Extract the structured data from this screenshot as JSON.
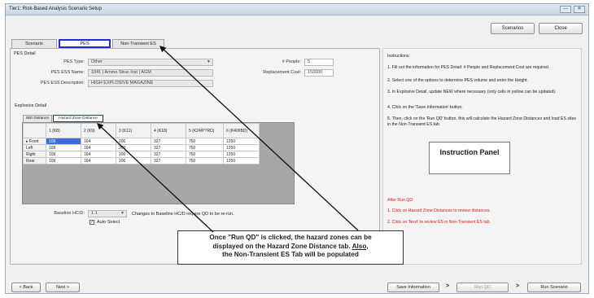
{
  "window": {
    "title": "Tier1: Risk-Based Analysis Scenario Setup",
    "controls": [
      "—",
      "✕"
    ]
  },
  "top_buttons": {
    "scenarios": "Scenarios",
    "close": "Close"
  },
  "tabs": [
    {
      "label": "Scenario",
      "active": false
    },
    {
      "label": "PES",
      "active": true
    },
    {
      "label": "Non-Transient ES",
      "active": false
    }
  ],
  "pes_detail": {
    "section_label": "PES Detail",
    "pes_type_label": "PES Type:",
    "pes_type_value": "Other",
    "pes_ess_name_label": "PES ESS Name:",
    "pes_ess_name_value": "1041 | Ammo Struc Inst | AGM",
    "pes_ess_desc_label": "PES ESS Description:",
    "pes_ess_desc_value": "HIGH EXPLOSIVE MAGAZINE",
    "people_label": "# People:",
    "people_value": "5",
    "replacement_label": "Replacement Cost:",
    "replacement_value": "150000"
  },
  "explosive_detail": {
    "section_label": "Explosive Detail",
    "subtabs": [
      {
        "label": "IBD Distance",
        "active": false
      },
      {
        "label": "Hazard Zone Distance",
        "active": true
      }
    ],
    "columns": [
      "",
      "1 (K8)",
      "2 (K9)",
      "3 (K11)",
      "4 (K18)",
      "5 (K24/PTRD)",
      "6 (K40/IBD)"
    ],
    "rows": [
      {
        "label": "Front",
        "values": [
          "109",
          "164",
          "200",
          "327",
          "750",
          "1250"
        ]
      },
      {
        "label": "Left",
        "values": [
          "109",
          "164",
          "200",
          "327",
          "750",
          "1250"
        ]
      },
      {
        "label": "Right",
        "values": [
          "109",
          "164",
          "200",
          "327",
          "750",
          "1250"
        ]
      },
      {
        "label": "Rear",
        "values": [
          "109",
          "164",
          "200",
          "327",
          "750",
          "1250"
        ]
      }
    ],
    "baseline_label": "Baseline HC/D:",
    "baseline_value": "1.1",
    "baseline_note": "Changes to Baseline HC/D require QD to be re-run.",
    "auto_select_label": "Auto Select"
  },
  "instructions": {
    "heading": "Instructions:",
    "steps": [
      "1. Fill out the information for PES Detail: # People and Replacement Cost are required.",
      "2. Select one of the options to determine PES volume and enter the Height.",
      "3. In Explosive Detail, update NEW where necessary (only cells in yellow can be updated).",
      "4. Click on the 'Save Information' button.",
      "5. Then, click on the 'Run QD' button, this will calculate the Hazard Zone Distances and load ES sites in the Non-Transient ES tab."
    ],
    "after_heading": "After Run QD:",
    "after_steps": [
      "1. Click on Hazard Zone Distances to review distances.",
      "2. Click on 'Next' to review ES in Non-Transient ES tab."
    ]
  },
  "instruction_panel_label": "Instruction Panel",
  "callout": {
    "line1": "Once \"Run QD\" is clicked, the hazard zones can be",
    "line2a": "displayed on the Hazard Zone Distance tab.",
    "line2b": "Also,",
    "line3": "the Non-Transient ES Tab will be populated"
  },
  "bottom_buttons": {
    "back": "< Back",
    "next": "Next >",
    "save": "Save Information",
    "run_qd": "Run QD",
    "run_scenario": "Run Scenario",
    "arrow": ">"
  }
}
